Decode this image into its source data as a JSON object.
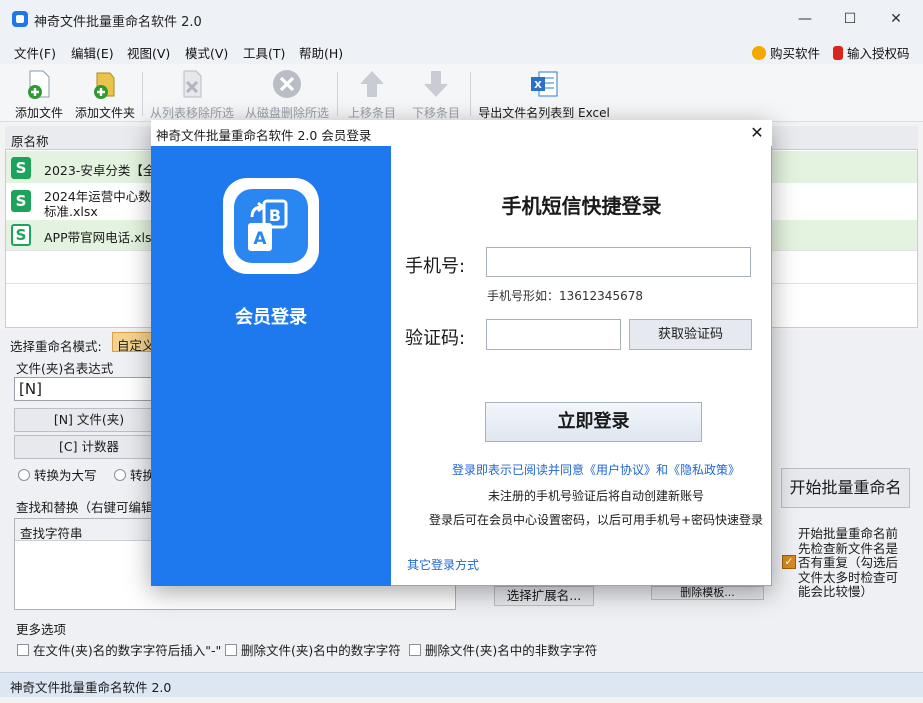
{
  "app": {
    "title": "神奇文件批量重命名软件 2.0",
    "window_controls": {
      "minimize": "—",
      "maximize": "☐",
      "close": "✕"
    }
  },
  "menu": {
    "items": [
      "文件(F)",
      "编辑(E)",
      "视图(V)",
      "模式(V)",
      "工具(T)",
      "帮助(H)"
    ],
    "buy": "购买软件",
    "license": "输入授权码"
  },
  "toolbar": {
    "add_file": "添加文件",
    "add_folder": "添加文件夹",
    "remove_from_list": "从列表移除所选",
    "delete_from_disk": "从磁盘删除所选",
    "move_up": "上移条目",
    "move_down": "下移条目",
    "export_excel": "导出文件名列表到 Excel"
  },
  "file_list": {
    "column_name": "原名称",
    "rows": [
      {
        "line1": "2023-安卓分类【全量",
        "line2": ""
      },
      {
        "line1": "2024年运营中心数据",
        "line2": "标准.xlsx"
      },
      {
        "line1": "APP带官网电话.xls",
        "line2": ""
      }
    ]
  },
  "lower": {
    "mode_label": "选择重命名模式:",
    "mode_value": "自定义",
    "expr_label": "文件(夹)名表达式",
    "expr_value": "[N]",
    "btn_n": "[N] 文件(夹)",
    "btn_c": "[C] 计数器",
    "radio_upper": "转换为大写",
    "radio_other": "转换",
    "find_replace_label": "查找和替换（右键可编辑",
    "find_col": "查找字符串",
    "select_ext": "选择扩展名...",
    "delete_template": "删除模板...",
    "start_button": "开始批量重命名",
    "check_dup_text": "开始批量重命名前先检查新文件名是否有重复（勾选后文件太多时检查可能会比较慢）",
    "more_options": "更多选项",
    "opt1": "在文件(夹)名的数字字符后插入\"-\"",
    "opt2": "删除文件(夹)名中的数字字符",
    "opt3": "删除文件(夹)名中的非数字字符"
  },
  "status": {
    "text": "神奇文件批量重命名软件 2.0"
  },
  "modal": {
    "title": "神奇文件批量重命名软件 2.0 会员登录",
    "close": "✕",
    "member_label": "会员登录",
    "form_title": "手机短信快捷登录",
    "phone_label": "手机号:",
    "phone_hint": "手机号形如：13612345678",
    "code_label": "验证码:",
    "get_code": "获取验证码",
    "login": "立即登录",
    "agree": "登录即表示已阅读并同意《用户协议》和《隐私政策》",
    "auto_create": "未注册的手机号验证后将自动创建新账号",
    "set_password": "登录后可在会员中心设置密码，以后可用手机号+密码快速登录",
    "other_login": "其它登录方式"
  },
  "colors": {
    "accent": "#1e78ee",
    "link": "#2166d0",
    "sheet_green": "#1ea35d"
  }
}
